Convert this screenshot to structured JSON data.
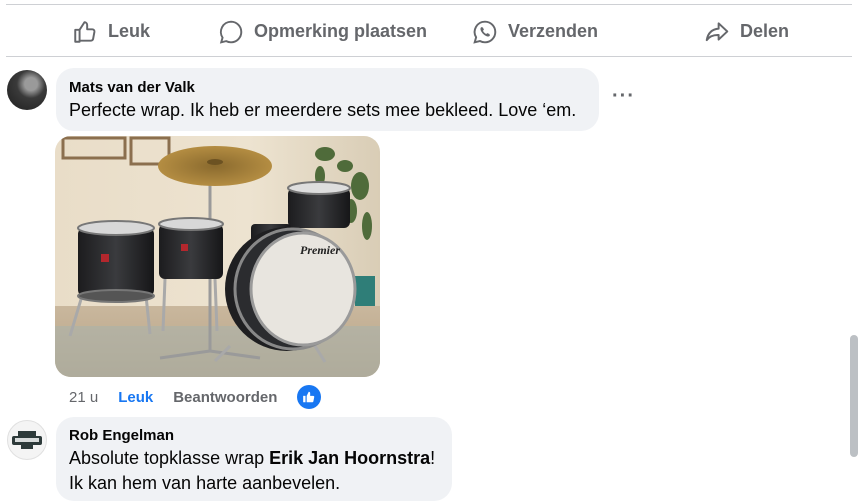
{
  "actions": {
    "like_label": "Leuk",
    "comment_label": "Opmerking plaatsen",
    "send_label": "Verzenden",
    "share_label": "Delen"
  },
  "comments": [
    {
      "author": "Mats van der Valk",
      "text": "Perfecte wrap. Ik heb er meerdere sets mee bekleed. Love ‘em.",
      "image": {
        "description_icon": "drum-kit-photo",
        "kick_drum_brand": "Premier"
      },
      "time": "21 u",
      "like_label": "Leuk",
      "reply_label": "Beantwoorden",
      "reaction_icon": "thumbs-up-icon"
    },
    {
      "author": "Rob Engelman",
      "text_before": "Absolute topklasse wrap ",
      "mention": "Erik Jan Hoornstra",
      "text_after": "!",
      "text_line2": "Ik kan hem van harte aanbevelen."
    }
  ],
  "colors": {
    "accent": "#1877f2",
    "muted": "#65676b",
    "bubble": "#f0f2f5"
  }
}
